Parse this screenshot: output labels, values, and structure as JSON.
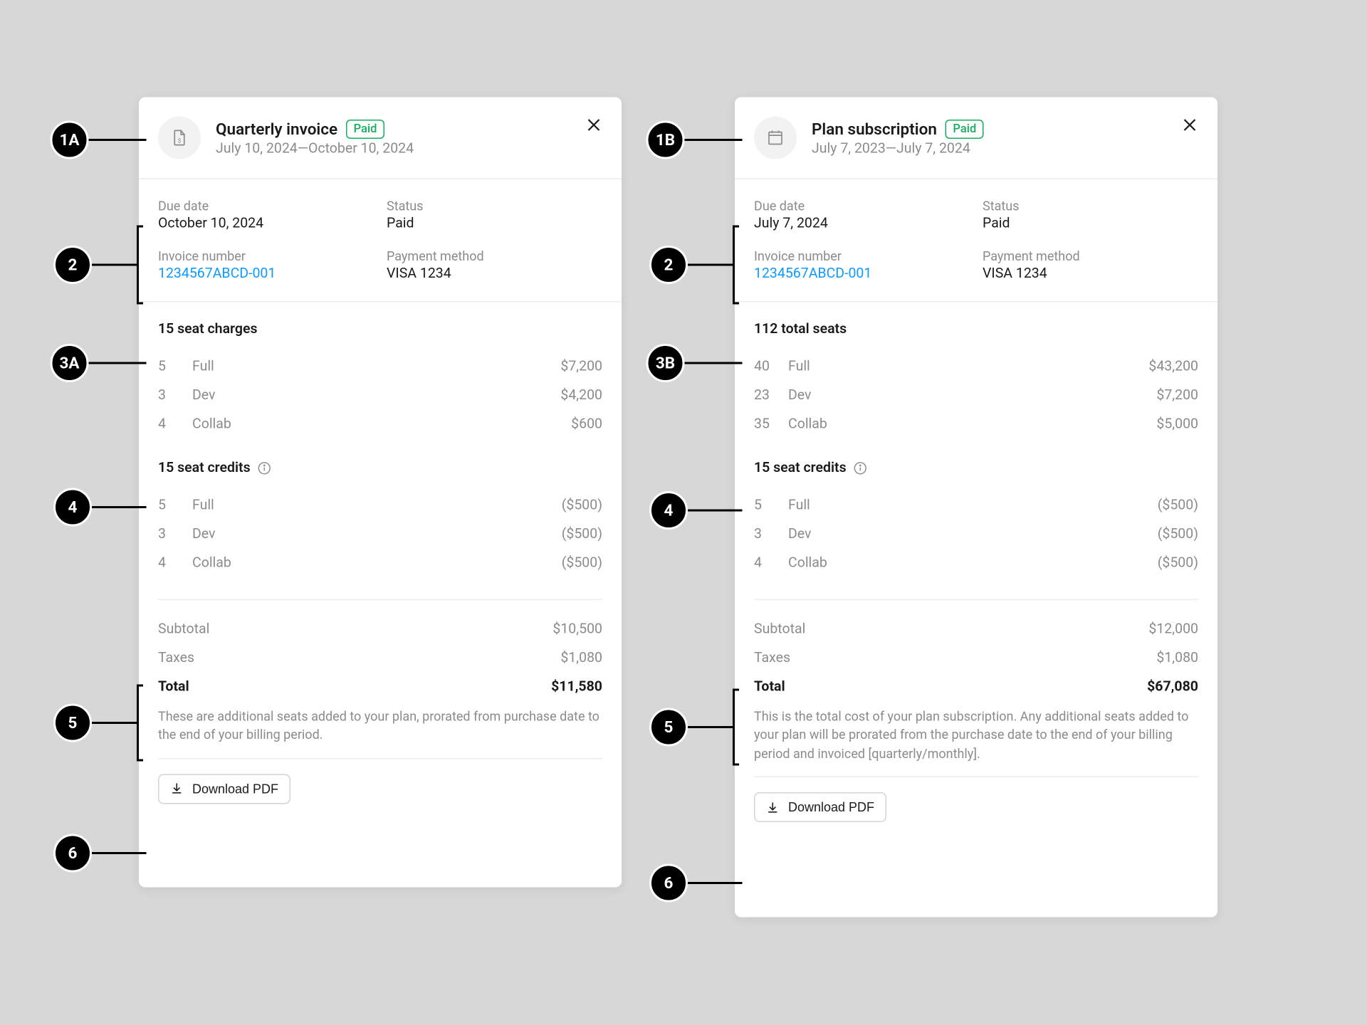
{
  "callouts": {
    "c1a": "1A",
    "c1b": "1B",
    "c2": "2",
    "c3a": "3A",
    "c3b": "3B",
    "c4": "4",
    "c5": "5",
    "c6": "6"
  },
  "cardA": {
    "title": "Quarterly invoice",
    "badge": "Paid",
    "dateRange": "July 10, 2024—October 10, 2024",
    "meta": {
      "dueDateLabel": "Due date",
      "dueDate": "October 10, 2024",
      "statusLabel": "Status",
      "status": "Paid",
      "invoiceNumLabel": "Invoice number",
      "invoiceNum": "1234567ABCD-001",
      "paymentLabel": "Payment method",
      "payment": "VISA 1234"
    },
    "chargesTitle": "15 seat charges",
    "charges": [
      {
        "qty": "5",
        "name": "Full",
        "value": "$7,200"
      },
      {
        "qty": "3",
        "name": "Dev",
        "value": "$4,200"
      },
      {
        "qty": "4",
        "name": "Collab",
        "value": "$600"
      }
    ],
    "creditsTitle": "15 seat credits",
    "credits": [
      {
        "qty": "5",
        "name": "Full",
        "value": "($500)"
      },
      {
        "qty": "3",
        "name": "Dev",
        "value": "($500)"
      },
      {
        "qty": "4",
        "name": "Collab",
        "value": "($500)"
      }
    ],
    "totals": {
      "subtotalLabel": "Subtotal",
      "subtotal": "$10,500",
      "taxesLabel": "Taxes",
      "taxes": "$1,080",
      "totalLabel": "Total",
      "total": "$11,580"
    },
    "helper": "These are additional seats added to your plan, prorated from purchase date to the end of your billing period.",
    "download": "Download PDF"
  },
  "cardB": {
    "title": "Plan subscription",
    "badge": "Paid",
    "dateRange": "July 7, 2023—July 7, 2024",
    "meta": {
      "dueDateLabel": "Due date",
      "dueDate": "July 7, 2024",
      "statusLabel": "Status",
      "status": "Paid",
      "invoiceNumLabel": "Invoice number",
      "invoiceNum": "1234567ABCD-001",
      "paymentLabel": "Payment method",
      "payment": "VISA 1234"
    },
    "chargesTitle": "112 total seats",
    "charges": [
      {
        "qty": "40",
        "name": "Full",
        "value": "$43,200"
      },
      {
        "qty": "23",
        "name": "Dev",
        "value": "$7,200"
      },
      {
        "qty": "35",
        "name": "Collab",
        "value": "$5,000"
      }
    ],
    "creditsTitle": "15 seat credits",
    "credits": [
      {
        "qty": "5",
        "name": "Full",
        "value": "($500)"
      },
      {
        "qty": "3",
        "name": "Dev",
        "value": "($500)"
      },
      {
        "qty": "4",
        "name": "Collab",
        "value": "($500)"
      }
    ],
    "totals": {
      "subtotalLabel": "Subtotal",
      "subtotal": "$12,000",
      "taxesLabel": "Taxes",
      "taxes": "$1,080",
      "totalLabel": "Total",
      "total": "$67,080"
    },
    "helper": "This is the total cost of your plan subscription. Any additional seats added to your plan will be prorated from the purchase date to the end of your billing period and invoiced [quarterly/monthly].",
    "download": "Download PDF"
  }
}
